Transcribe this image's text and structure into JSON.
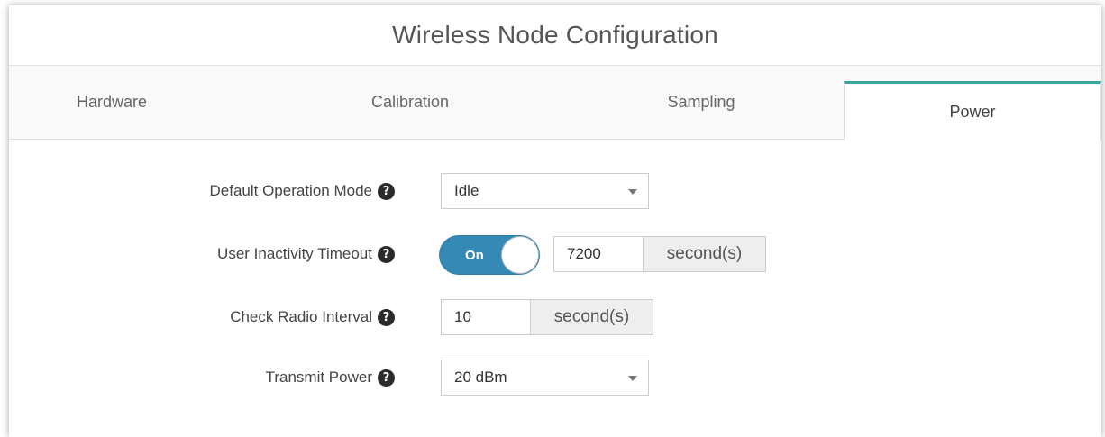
{
  "window": {
    "title": "Wireless Node Configuration"
  },
  "tabs": [
    {
      "label": "Hardware",
      "active": false
    },
    {
      "label": "Calibration",
      "active": false
    },
    {
      "label": "Sampling",
      "active": false
    },
    {
      "label": "Power",
      "active": true
    }
  ],
  "form": {
    "default_operation_mode": {
      "label": "Default Operation Mode",
      "value": "Idle",
      "help_icon": "question-circle-icon"
    },
    "user_inactivity_timeout": {
      "label": "User Inactivity Timeout",
      "toggle_label": "On",
      "toggle_state": true,
      "value": "7200",
      "unit": "second(s)",
      "help_icon": "question-circle-icon"
    },
    "check_radio_interval": {
      "label": "Check Radio Interval",
      "value": "10",
      "unit": "second(s)",
      "help_icon": "question-circle-icon"
    },
    "transmit_power": {
      "label": "Transmit Power",
      "value": "20 dBm",
      "help_icon": "question-circle-icon"
    }
  },
  "colors": {
    "accent": "#3ca69c",
    "toggle_on": "#3589b5"
  }
}
